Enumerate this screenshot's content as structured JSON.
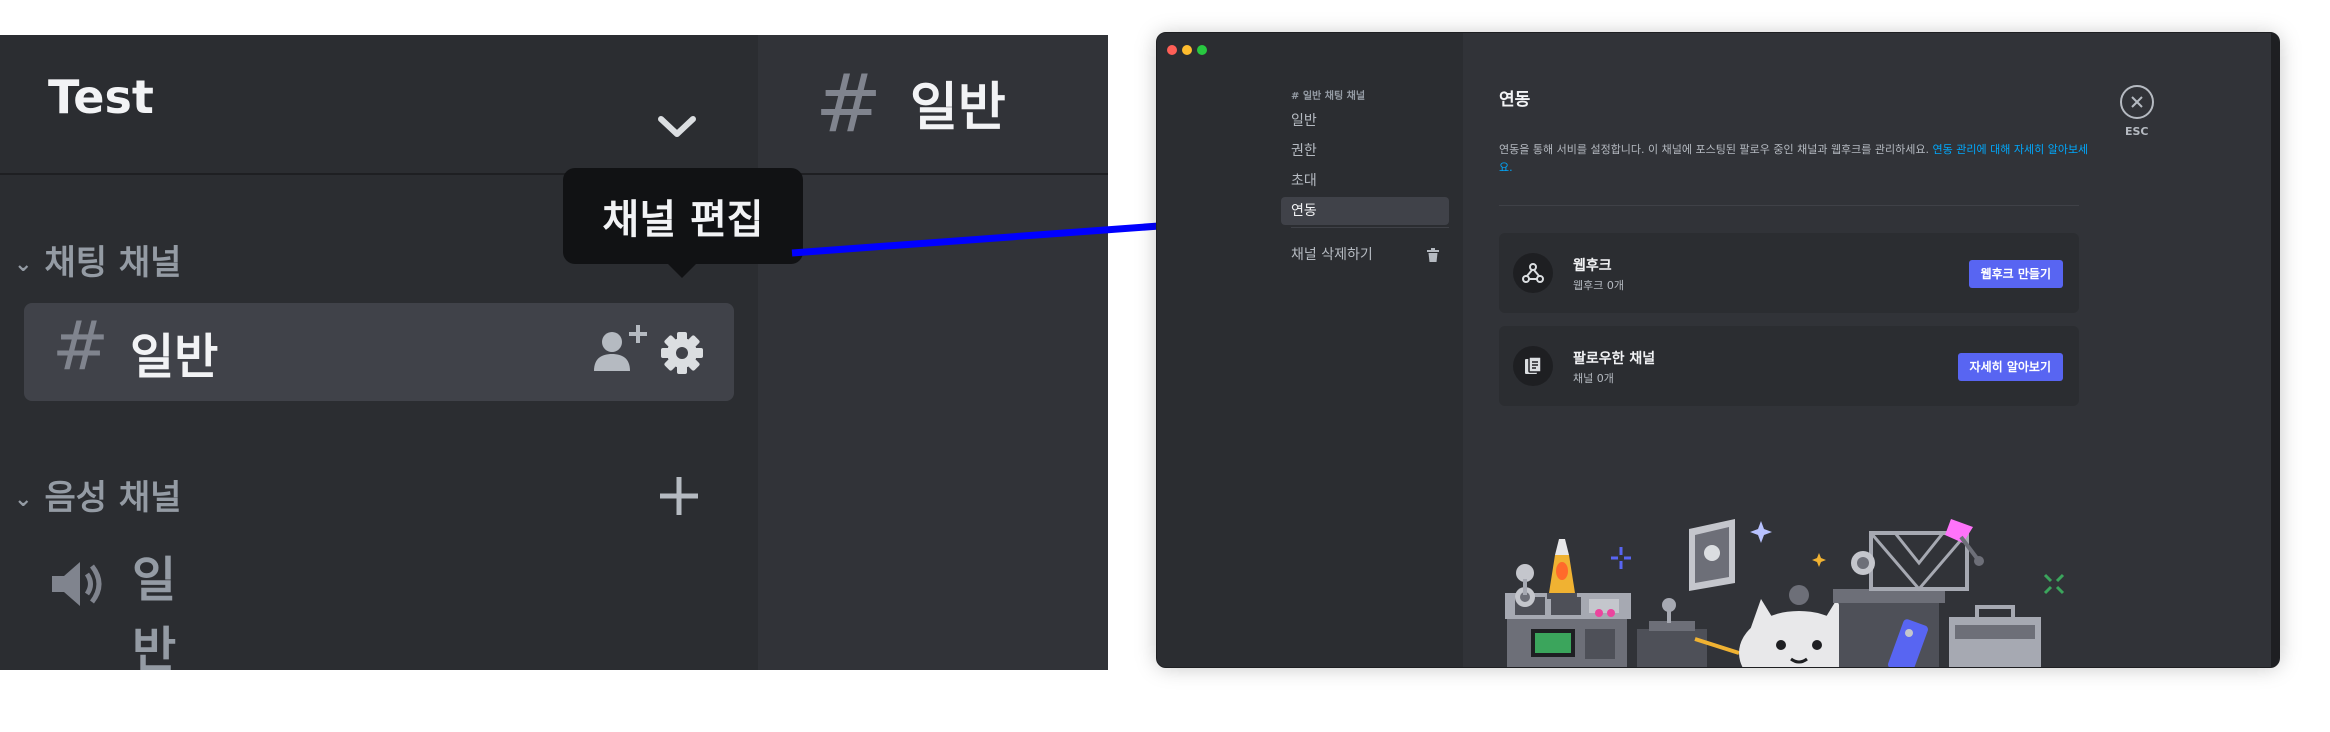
{
  "left_panel": {
    "server_name": "Test",
    "channel_header": {
      "hash": "#",
      "name": "일반"
    },
    "text_category": {
      "arrow": "⌄",
      "label": "채팅 채널"
    },
    "selected_channel": {
      "hash": "#",
      "name": "일반"
    },
    "voice_category": {
      "arrow": "⌄",
      "label": "음성 채널"
    },
    "voice_channel": {
      "name": "일반"
    },
    "tooltip": "채널 편집",
    "icons": [
      "chevron-down-icon",
      "add-member-icon",
      "gear-icon",
      "plus-icon",
      "speaker-icon"
    ]
  },
  "arrow_color": "#0000ff",
  "settings_window": {
    "nav": {
      "header": "# 일반 채팅 채널",
      "items": [
        {
          "label": "일반",
          "active": false
        },
        {
          "label": "권한",
          "active": false
        },
        {
          "label": "초대",
          "active": false
        },
        {
          "label": "연동",
          "active": true
        }
      ],
      "delete_label": "채널 삭제하기"
    },
    "content": {
      "title": "연동",
      "description": "연동을 통해 서비를 설정합니다. 이 채널에 포스팅된 팔로우 중인 채널과 웹후크를 관리하세요. ",
      "description_link": "연동 관리에 대해 자세히 알아보세요.",
      "cards": [
        {
          "title": "웹후크",
          "subtitle": "웹후크 0개",
          "button": "웹후크 만들기",
          "icon": "webhook-icon"
        },
        {
          "title": "팔로우한 채널",
          "subtitle": "채널 0개",
          "button": "자세히 알아보기",
          "icon": "follow-channel-icon"
        }
      ],
      "close_label": "ESC"
    },
    "colors": {
      "accent": "#5865f2",
      "link": "#00a8fc",
      "bg": "#313338",
      "nav_bg": "#2b2d31"
    }
  }
}
